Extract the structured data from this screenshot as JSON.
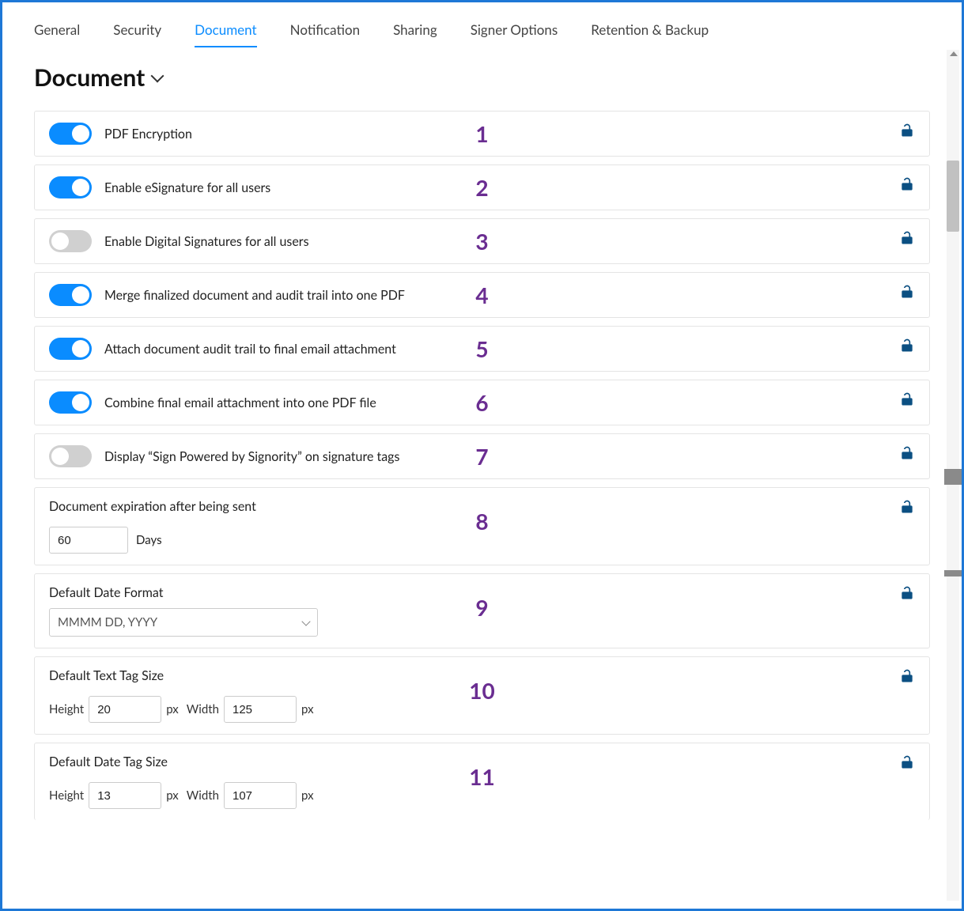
{
  "tabs": [
    {
      "label": "General",
      "active": false
    },
    {
      "label": "Security",
      "active": false
    },
    {
      "label": "Document",
      "active": true
    },
    {
      "label": "Notification",
      "active": false
    },
    {
      "label": "Sharing",
      "active": false
    },
    {
      "label": "Signer Options",
      "active": false
    },
    {
      "label": "Retention & Backup",
      "active": false
    }
  ],
  "title": "Document",
  "rows": [
    {
      "n": "1",
      "label": "PDF Encryption",
      "toggle": true,
      "on": true
    },
    {
      "n": "2",
      "label": "Enable eSignature for all users",
      "toggle": true,
      "on": true
    },
    {
      "n": "3",
      "label": "Enable Digital Signatures for all users",
      "toggle": true,
      "on": false
    },
    {
      "n": "4",
      "label": "Merge finalized document and audit trail into one PDF",
      "toggle": true,
      "on": true
    },
    {
      "n": "5",
      "label": "Attach document audit trail to final email attachment",
      "toggle": true,
      "on": true
    },
    {
      "n": "6",
      "label": "Combine final email attachment into one PDF file",
      "toggle": true,
      "on": true
    },
    {
      "n": "7",
      "label": "Display “Sign Powered by Signority” on signature tags",
      "toggle": true,
      "on": false
    }
  ],
  "expiration": {
    "n": "8",
    "label": "Document expiration after being sent",
    "value": "60",
    "unit": "Days"
  },
  "dateFormat": {
    "n": "9",
    "label": "Default Date Format",
    "value": "MMMM DD, YYYY"
  },
  "textTag": {
    "n": "10",
    "label": "Default Text Tag Size",
    "heightLabel": "Height",
    "height": "20",
    "px1": "px",
    "widthLabel": "Width",
    "width": "125",
    "px2": "px"
  },
  "dateTag": {
    "n": "11",
    "label": "Default Date Tag Size",
    "heightLabel": "Height",
    "height": "13",
    "px1": "px",
    "widthLabel": "Width",
    "width": "107",
    "px2": "px"
  }
}
